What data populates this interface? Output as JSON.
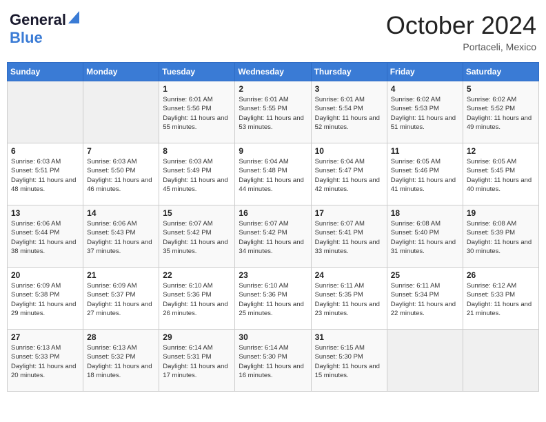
{
  "header": {
    "logo_line1": "General",
    "logo_line2": "Blue",
    "month": "October 2024",
    "location": "Portaceli, Mexico"
  },
  "days_of_week": [
    "Sunday",
    "Monday",
    "Tuesday",
    "Wednesday",
    "Thursday",
    "Friday",
    "Saturday"
  ],
  "weeks": [
    [
      {
        "day": "",
        "detail": ""
      },
      {
        "day": "",
        "detail": ""
      },
      {
        "day": "1",
        "sunrise": "Sunrise: 6:01 AM",
        "sunset": "Sunset: 5:56 PM",
        "daylight": "Daylight: 11 hours and 55 minutes."
      },
      {
        "day": "2",
        "sunrise": "Sunrise: 6:01 AM",
        "sunset": "Sunset: 5:55 PM",
        "daylight": "Daylight: 11 hours and 53 minutes."
      },
      {
        "day": "3",
        "sunrise": "Sunrise: 6:01 AM",
        "sunset": "Sunset: 5:54 PM",
        "daylight": "Daylight: 11 hours and 52 minutes."
      },
      {
        "day": "4",
        "sunrise": "Sunrise: 6:02 AM",
        "sunset": "Sunset: 5:53 PM",
        "daylight": "Daylight: 11 hours and 51 minutes."
      },
      {
        "day": "5",
        "sunrise": "Sunrise: 6:02 AM",
        "sunset": "Sunset: 5:52 PM",
        "daylight": "Daylight: 11 hours and 49 minutes."
      }
    ],
    [
      {
        "day": "6",
        "sunrise": "Sunrise: 6:03 AM",
        "sunset": "Sunset: 5:51 PM",
        "daylight": "Daylight: 11 hours and 48 minutes."
      },
      {
        "day": "7",
        "sunrise": "Sunrise: 6:03 AM",
        "sunset": "Sunset: 5:50 PM",
        "daylight": "Daylight: 11 hours and 46 minutes."
      },
      {
        "day": "8",
        "sunrise": "Sunrise: 6:03 AM",
        "sunset": "Sunset: 5:49 PM",
        "daylight": "Daylight: 11 hours and 45 minutes."
      },
      {
        "day": "9",
        "sunrise": "Sunrise: 6:04 AM",
        "sunset": "Sunset: 5:48 PM",
        "daylight": "Daylight: 11 hours and 44 minutes."
      },
      {
        "day": "10",
        "sunrise": "Sunrise: 6:04 AM",
        "sunset": "Sunset: 5:47 PM",
        "daylight": "Daylight: 11 hours and 42 minutes."
      },
      {
        "day": "11",
        "sunrise": "Sunrise: 6:05 AM",
        "sunset": "Sunset: 5:46 PM",
        "daylight": "Daylight: 11 hours and 41 minutes."
      },
      {
        "day": "12",
        "sunrise": "Sunrise: 6:05 AM",
        "sunset": "Sunset: 5:45 PM",
        "daylight": "Daylight: 11 hours and 40 minutes."
      }
    ],
    [
      {
        "day": "13",
        "sunrise": "Sunrise: 6:06 AM",
        "sunset": "Sunset: 5:44 PM",
        "daylight": "Daylight: 11 hours and 38 minutes."
      },
      {
        "day": "14",
        "sunrise": "Sunrise: 6:06 AM",
        "sunset": "Sunset: 5:43 PM",
        "daylight": "Daylight: 11 hours and 37 minutes."
      },
      {
        "day": "15",
        "sunrise": "Sunrise: 6:07 AM",
        "sunset": "Sunset: 5:42 PM",
        "daylight": "Daylight: 11 hours and 35 minutes."
      },
      {
        "day": "16",
        "sunrise": "Sunrise: 6:07 AM",
        "sunset": "Sunset: 5:42 PM",
        "daylight": "Daylight: 11 hours and 34 minutes."
      },
      {
        "day": "17",
        "sunrise": "Sunrise: 6:07 AM",
        "sunset": "Sunset: 5:41 PM",
        "daylight": "Daylight: 11 hours and 33 minutes."
      },
      {
        "day": "18",
        "sunrise": "Sunrise: 6:08 AM",
        "sunset": "Sunset: 5:40 PM",
        "daylight": "Daylight: 11 hours and 31 minutes."
      },
      {
        "day": "19",
        "sunrise": "Sunrise: 6:08 AM",
        "sunset": "Sunset: 5:39 PM",
        "daylight": "Daylight: 11 hours and 30 minutes."
      }
    ],
    [
      {
        "day": "20",
        "sunrise": "Sunrise: 6:09 AM",
        "sunset": "Sunset: 5:38 PM",
        "daylight": "Daylight: 11 hours and 29 minutes."
      },
      {
        "day": "21",
        "sunrise": "Sunrise: 6:09 AM",
        "sunset": "Sunset: 5:37 PM",
        "daylight": "Daylight: 11 hours and 27 minutes."
      },
      {
        "day": "22",
        "sunrise": "Sunrise: 6:10 AM",
        "sunset": "Sunset: 5:36 PM",
        "daylight": "Daylight: 11 hours and 26 minutes."
      },
      {
        "day": "23",
        "sunrise": "Sunrise: 6:10 AM",
        "sunset": "Sunset: 5:36 PM",
        "daylight": "Daylight: 11 hours and 25 minutes."
      },
      {
        "day": "24",
        "sunrise": "Sunrise: 6:11 AM",
        "sunset": "Sunset: 5:35 PM",
        "daylight": "Daylight: 11 hours and 23 minutes."
      },
      {
        "day": "25",
        "sunrise": "Sunrise: 6:11 AM",
        "sunset": "Sunset: 5:34 PM",
        "daylight": "Daylight: 11 hours and 22 minutes."
      },
      {
        "day": "26",
        "sunrise": "Sunrise: 6:12 AM",
        "sunset": "Sunset: 5:33 PM",
        "daylight": "Daylight: 11 hours and 21 minutes."
      }
    ],
    [
      {
        "day": "27",
        "sunrise": "Sunrise: 6:13 AM",
        "sunset": "Sunset: 5:33 PM",
        "daylight": "Daylight: 11 hours and 20 minutes."
      },
      {
        "day": "28",
        "sunrise": "Sunrise: 6:13 AM",
        "sunset": "Sunset: 5:32 PM",
        "daylight": "Daylight: 11 hours and 18 minutes."
      },
      {
        "day": "29",
        "sunrise": "Sunrise: 6:14 AM",
        "sunset": "Sunset: 5:31 PM",
        "daylight": "Daylight: 11 hours and 17 minutes."
      },
      {
        "day": "30",
        "sunrise": "Sunrise: 6:14 AM",
        "sunset": "Sunset: 5:30 PM",
        "daylight": "Daylight: 11 hours and 16 minutes."
      },
      {
        "day": "31",
        "sunrise": "Sunrise: 6:15 AM",
        "sunset": "Sunset: 5:30 PM",
        "daylight": "Daylight: 11 hours and 15 minutes."
      },
      {
        "day": "",
        "detail": ""
      },
      {
        "day": "",
        "detail": ""
      }
    ]
  ]
}
